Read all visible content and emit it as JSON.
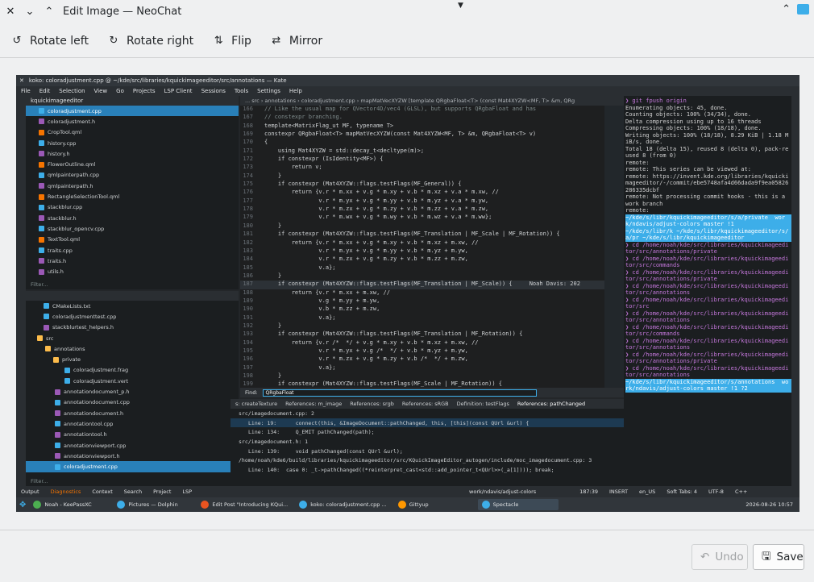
{
  "window": {
    "title": "Edit Image — NeoChat"
  },
  "toolbar": {
    "rotate_left": "Rotate left",
    "rotate_right": "Rotate right",
    "flip": "Flip",
    "mirror": "Mirror"
  },
  "footer": {
    "undo": "Undo",
    "save": "Save"
  },
  "shot": {
    "kate_title": "koko: coloradjustment.cpp @ ~/kde/src/libraries/kquickimageeditor/src/annotations — Kate",
    "menu": [
      "File",
      "Edit",
      "Selection",
      "View",
      "Go",
      "Projects",
      "LSP Client",
      "Sessions",
      "Tools",
      "Settings",
      "Help"
    ],
    "project_name": "kquickimageeditor",
    "project_files": [
      "coloradjustment.cpp",
      "coloradjustment.h",
      "CropTool.qml",
      "history.cpp",
      "history.h",
      "FlowerOutline.qml",
      "qmlpainterpath.cpp",
      "qmlpainterpath.h",
      "RectangleSelectionTool.qml",
      "stackblur.cpp",
      "stackblur.h",
      "stackblur_opencv.cpp",
      "TextTool.qml",
      "traits.cpp",
      "traits.h",
      "utils.h"
    ],
    "filter": "Filter...",
    "doc_files": [
      "CMakeLists.txt",
      "coloradjustmenttest.cpp",
      "stackblurtest_helpers.h",
      "src",
      "annotations",
      "private",
      "coloradjustment.frag",
      "coloradjustment.vert",
      "annotationdocument_p.h",
      "annotationdocument.cpp",
      "annotationdocument.h",
      "annotationtool.cpp",
      "annotationtool.h",
      "annotationviewport.cpp",
      "annotationviewport.h",
      "coloradjustment.cpp"
    ],
    "breadcrumb": "... src › annotations › coloradjustment.cpp › mapMatVecXYZW [template QRgbaFloat<T> (const Mat4XYZW<MF, T> &m, QRg",
    "code": [
      {
        "n": "166",
        "t": "// Like the usual map for QVector4D/vec4 (GLSL), but supports QRgbaFloat and has"
      },
      {
        "n": "167",
        "t": "// constexpr branching."
      },
      {
        "n": "168",
        "t": "template<MatrixFlag_ut MF, typename T>"
      },
      {
        "n": "169",
        "t": "constexpr QRgbaFloat<T> mapMatVecXYZW(const Mat4XYZW<MF, T> &m, QRgbaFloat<T> v)"
      },
      {
        "n": "170",
        "t": "{"
      },
      {
        "n": "171",
        "t": "    using Mat4XYZW = std::decay_t<decltype(m)>;"
      },
      {
        "n": "172",
        "t": "    if constexpr (IsIdentity<MF>) {"
      },
      {
        "n": "173",
        "t": "        return v;"
      },
      {
        "n": "174",
        "t": "    }"
      },
      {
        "n": "175",
        "t": "    if constexpr (Mat4XYZW::flags.testFlags(MF_General)) {"
      },
      {
        "n": "176",
        "t": "        return {v.r * m.xx + v.g * m.xy + v.b * m.xz + v.a * m.xw, //"
      },
      {
        "n": "177",
        "t": "                v.r * m.yx + v.g * m.yy + v.b * m.yz + v.a * m.yw,"
      },
      {
        "n": "178",
        "t": "                v.r * m.zx + v.g * m.zy + v.b * m.zz + v.a * m.zw,"
      },
      {
        "n": "179",
        "t": "                v.r * m.wx + v.g * m.wy + v.b * m.wz + v.a * m.ww};"
      },
      {
        "n": "180",
        "t": "    }"
      },
      {
        "n": "181",
        "t": "    if constexpr (Mat4XYZW::flags.testFlags(MF_Translation | MF_Scale | MF_Rotation)) {"
      },
      {
        "n": "182",
        "t": "        return {v.r * m.xx + v.g * m.xy + v.b * m.xz + m.xw, //"
      },
      {
        "n": "183",
        "t": "                v.r * m.yx + v.g * m.yy + v.b * m.yz + m.yw,"
      },
      {
        "n": "184",
        "t": "                v.r * m.zx + v.g * m.zy + v.b * m.zz + m.zw,"
      },
      {
        "n": "185",
        "t": "                v.a};"
      },
      {
        "n": "186",
        "t": "    }"
      },
      {
        "n": "187",
        "t": "    if constexpr (Mat4XYZW::flags.testFlags(MF_Translation | MF_Scale)) {     Noah Davis: 202"
      },
      {
        "n": "188",
        "t": "        return {v.r * m.xx + m.xw, //"
      },
      {
        "n": "189",
        "t": "                v.g * m.yy + m.yw,"
      },
      {
        "n": "190",
        "t": "                v.b * m.zz + m.zw,"
      },
      {
        "n": "191",
        "t": "                v.a};"
      },
      {
        "n": "192",
        "t": "    }"
      },
      {
        "n": "193",
        "t": "    if constexpr (Mat4XYZW::flags.testFlags(MF_Translation | MF_Rotation)) {"
      },
      {
        "n": "194",
        "t": "        return {v.r /*  */ + v.g * m.xy + v.b * m.xz + m.xw, //"
      },
      {
        "n": "195",
        "t": "                v.r * m.yx + v.g /*  */ + v.b * m.yz + m.yw,"
      },
      {
        "n": "196",
        "t": "                v.r * m.zx + v.g * m.zy + v.b /*  */ + m.zw,"
      },
      {
        "n": "197",
        "t": "                v.a};"
      },
      {
        "n": "198",
        "t": "    }"
      },
      {
        "n": "199",
        "t": "    if constexpr (Mat4XYZW::flags.testFlags(MF_Scale | MF_Rotation)) {"
      }
    ],
    "find_label": "Find:",
    "find_value": "QRgbaFloat",
    "ref_tabs": [
      "s: createTexture",
      "References: m_image",
      "References: srgb",
      "References: sRGB",
      "Definition: testFlags",
      "References: pathChanged"
    ],
    "refs": [
      "src/imagedocument.cpp: 2",
      "Line: 19:      connect(this, &ImageDocument::pathChanged, this, [this](const QUrl &url) {",
      "Line: 134:     Q_EMIT pathChanged(path);",
      "src/imagedocument.h: 1",
      "Line: 139:     void pathChanged(const QUrl &url);",
      "/home/noah/kde6/build/libraries/kquickimageeditor/src/KQuickImageEditor_autogen/include/moc_imagedocument.cpp: 3",
      "Line: 140:  case 0: _t->pathChanged((*reinterpret_cast<std::add_pointer_t<QUrl>>(_a[1]))); break;"
    ],
    "terminal": [
      "❯ git fpush origin",
      "Enumerating objects: 45, done.",
      "Counting objects: 100% (34/34), done.",
      "Delta compression using up to 16 threads",
      "Compressing objects: 100% (18/18), done.",
      "Writing objects: 100% (18/18), 8.29 KiB | 1.18 MiB/s, done.",
      "Total 18 (delta 15), reused 8 (delta 0), pack-reused 8 (from 0)",
      "remote:",
      "remote: This series can be viewed at:",
      "remote: https://invent.kde.org/libraries/kquickimageeditor/-/commit/ebe5748afa4d66dada9f9ea05826286335dcbf",
      "remote: Not processing commit hooks - this is a work branch",
      "remote:",
      "~/kde/s/libr/kquickimageeditor/s/a/private  work/ndavis/adjust-colors master !1",
      "~/kde/s/libr/k ~/kde/s/libr/kquickimageeditor/s/a/pr ~/kde/s/libr/kquickimageeditor",
      "❯ cd /home/noah/kde/src/libraries/kquickimageeditor/src/annotations/private",
      "❯ cd /home/noah/kde/src/libraries/kquickimageeditor/src/commands",
      "❯ cd /home/noah/kde/src/libraries/kquickimageeditor/src/annotations/private",
      "❯ cd /home/noah/kde/src/libraries/kquickimageeditor/src/annotations",
      "❯ cd /home/noah/kde/src/libraries/kquickimageeditor/src",
      "❯ cd /home/noah/kde/src/libraries/kquickimageeditor/src/annotations",
      "❯ cd /home/noah/kde/src/libraries/kquickimageeditor/src/commands",
      "❯ cd /home/noah/kde/src/libraries/kquickimageeditor/src/annotations",
      "❯ cd /home/noah/kde/src/libraries/kquickimageeditor/src/annotations/private",
      "❯ cd /home/noah/kde/src/libraries/kquickimageeditor/src/annotations",
      "~/kde/s/libr/kquickimageeditor/s/annotations  work/ndavis/adjust-colors master !1 ?2"
    ],
    "status": {
      "output": "Output",
      "diagnostics": "Diagnostics",
      "context": "Context",
      "search": "Search",
      "project": "Project",
      "lsp": "LSP",
      "branch": "work/ndavis/adjust-colors",
      "pos": "187:39",
      "mode": "INSERT",
      "lang": "en_US",
      "tabs": "Soft Tabs: 4",
      "enc": "UTF-8",
      "syntax": "C++"
    },
    "taskbar": [
      "Noah - KeePassXC",
      "Pictures — Dolphin",
      "Edit Post \"Introducing KQui...",
      "koko: coloradjustment.cpp ...",
      "Gittyup",
      "Spectacle"
    ],
    "clock": "2026-08-26 10:57"
  }
}
